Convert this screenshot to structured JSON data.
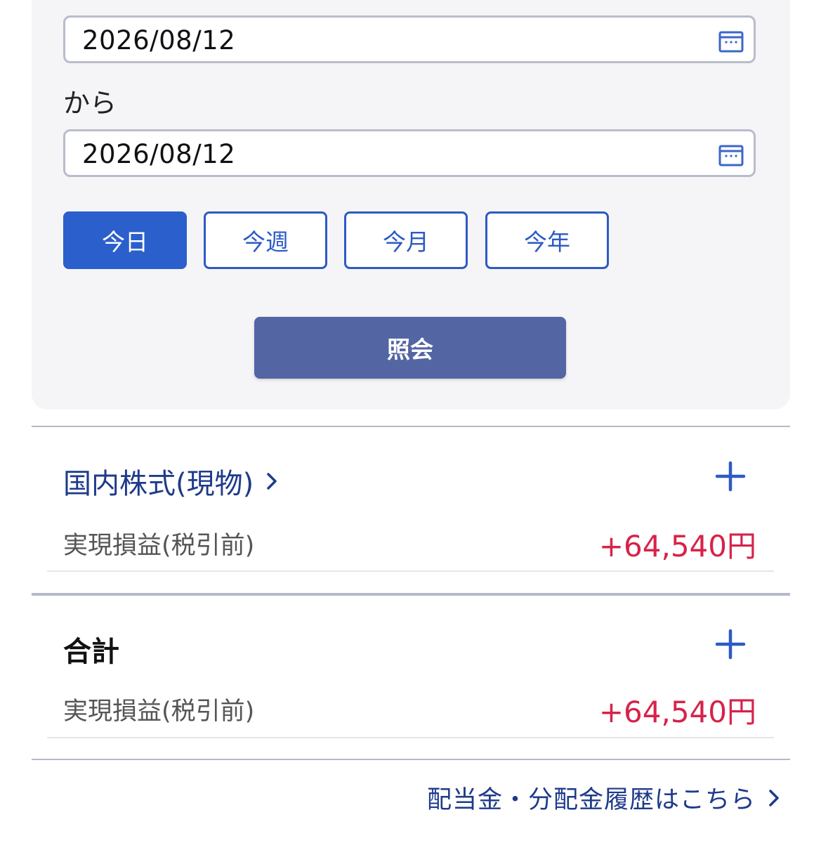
{
  "search_panel": {
    "start_date": "2026/08/12",
    "separator": "から",
    "end_date": "2026/08/12",
    "range_buttons": [
      "今日",
      "今週",
      "今月",
      "今年"
    ],
    "active_range": "今日",
    "query_button": "照会"
  },
  "sections": [
    {
      "title": "国内株式(現物)",
      "label": "実現損益(税引前)",
      "value": "+64,540円"
    },
    {
      "title": "合計",
      "label": "実現損益(税引前)",
      "value": "+64,540円"
    }
  ],
  "footer": {
    "dividend_link": "配当金・分配金履歴はこちら"
  },
  "colors": {
    "primary_blue": "#2b5fcb",
    "navy_text": "#1e3a8a",
    "query_button": "#5465a4",
    "profit_red": "#d6234a"
  }
}
